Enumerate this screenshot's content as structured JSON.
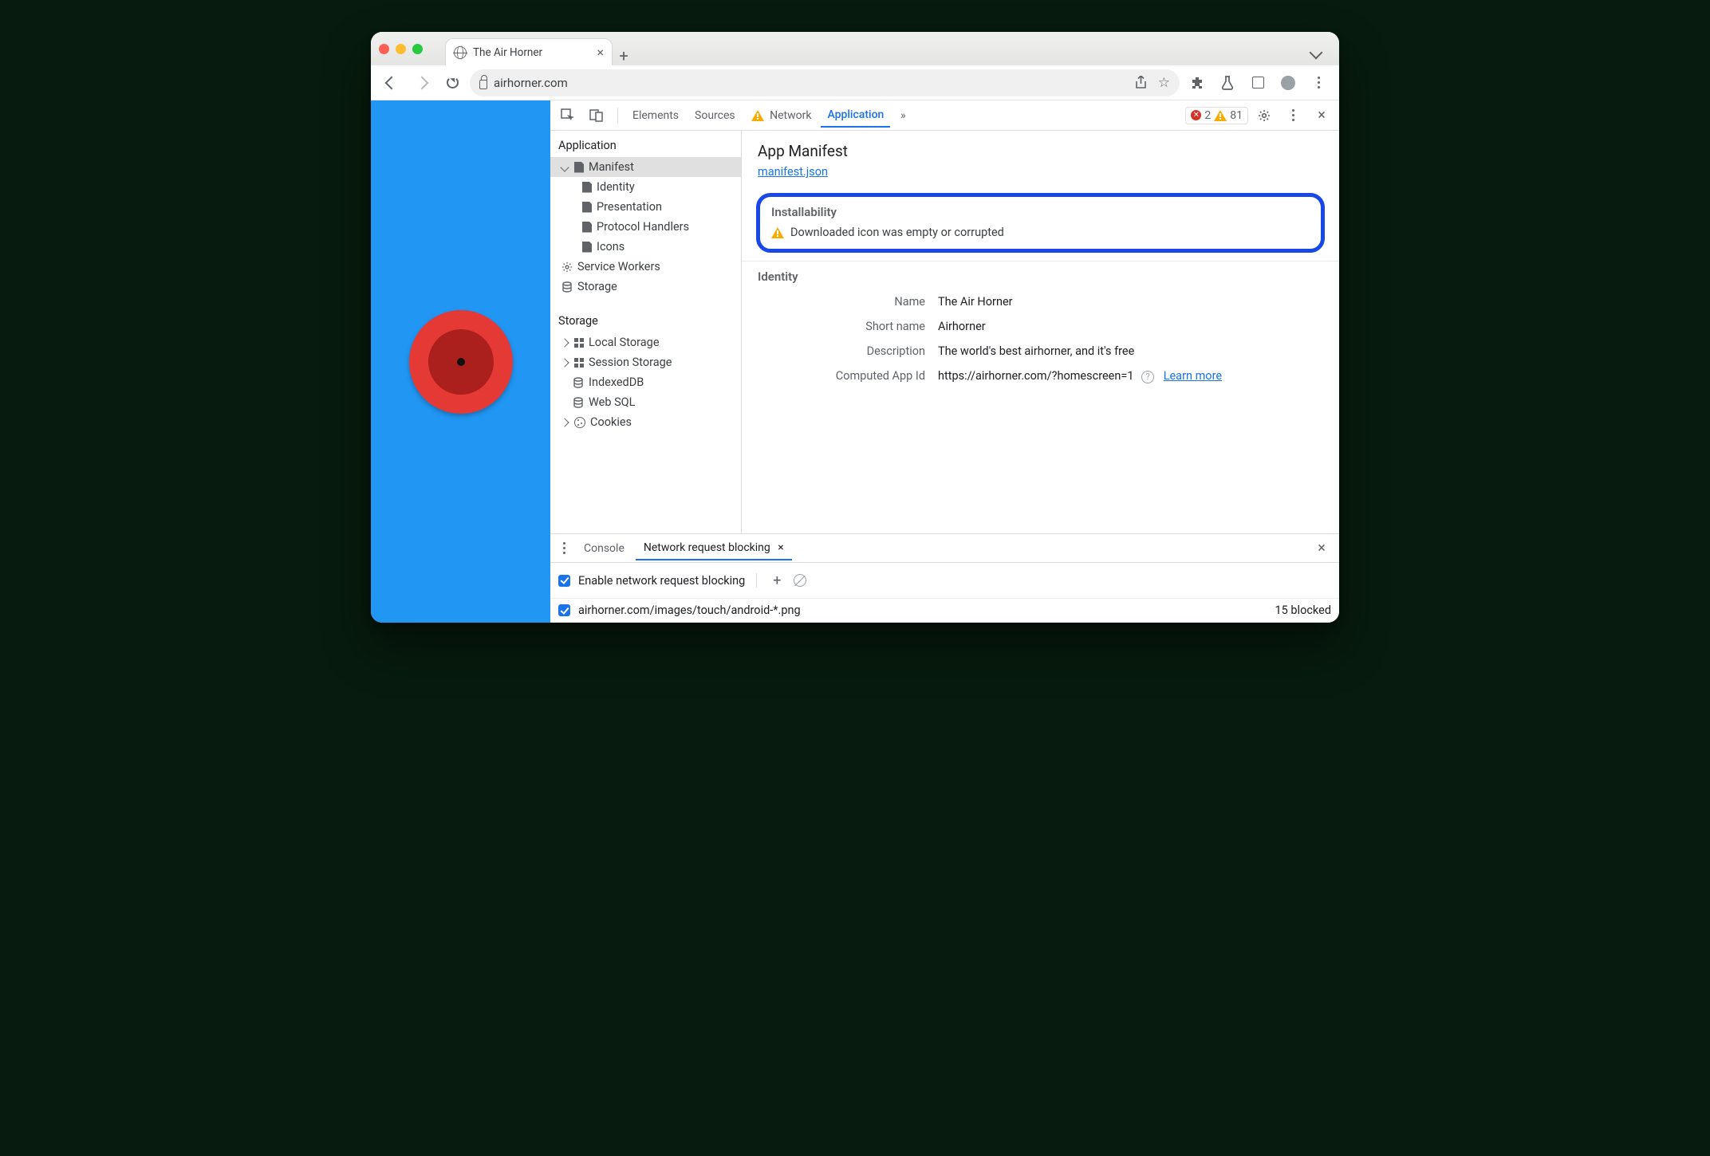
{
  "browser": {
    "tab_title": "The Air Horner",
    "url_display": "airhorner.com"
  },
  "devtools": {
    "tabs": [
      "Elements",
      "Sources",
      "Network",
      "Application"
    ],
    "active_tab": "Application",
    "error_count": "2",
    "warn_count": "81"
  },
  "sidebar": {
    "groups": [
      {
        "title": "Application",
        "items": [
          "Manifest",
          "Identity",
          "Presentation",
          "Protocol Handlers",
          "Icons",
          "Service Workers",
          "Storage"
        ]
      },
      {
        "title": "Storage",
        "items": [
          "Local Storage",
          "Session Storage",
          "IndexedDB",
          "Web SQL",
          "Cookies"
        ]
      }
    ]
  },
  "manifest": {
    "heading": "App Manifest",
    "link": "manifest.json",
    "installability_heading": "Installability",
    "installability_warning": "Downloaded icon was empty or corrupted",
    "identity_heading": "Identity",
    "fields": {
      "name_label": "Name",
      "name_value": "The Air Horner",
      "shortname_label": "Short name",
      "shortname_value": "Airhorner",
      "description_label": "Description",
      "description_value": "The world's best airhorner, and it's free",
      "appid_label": "Computed App Id",
      "appid_value": "https://airhorner.com/?homescreen=1",
      "learn_more": "Learn more"
    }
  },
  "drawer": {
    "tabs": [
      "Console",
      "Network request blocking"
    ],
    "enable_label": "Enable network request blocking",
    "pattern": "airhorner.com/images/touch/android-*.png",
    "blocked_text": "15 blocked"
  }
}
